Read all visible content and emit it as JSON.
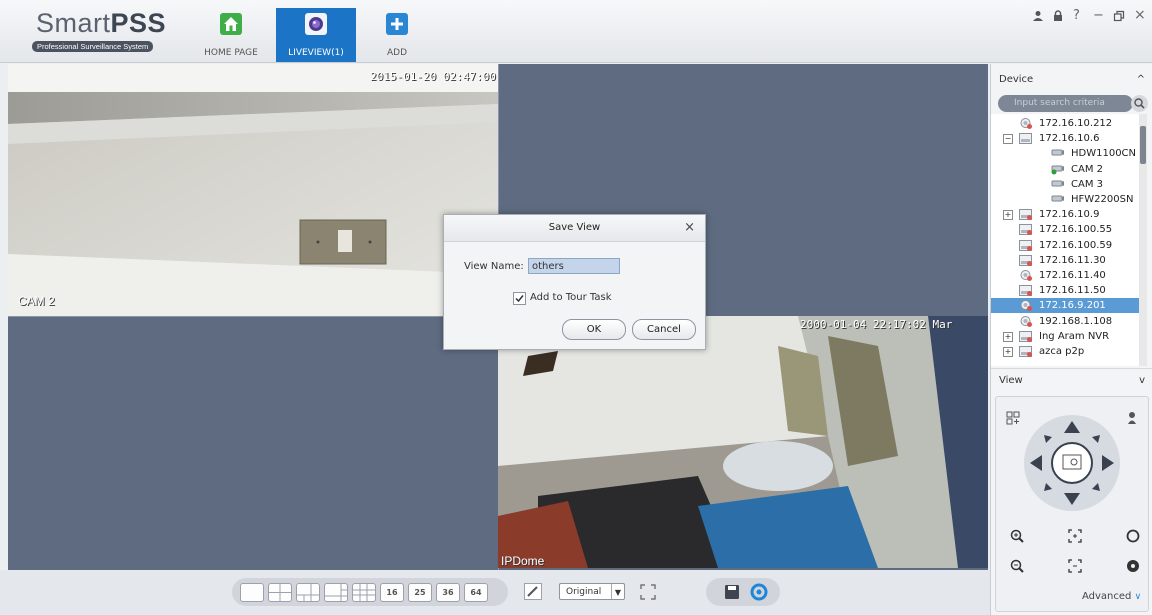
{
  "app": {
    "logo_title_light": "Smart",
    "logo_title_bold": "PSS",
    "logo_subtitle": "Professional Surveillance System"
  },
  "tabs": [
    {
      "label": "HOME PAGE",
      "icon": "home-icon",
      "color": "#3fae49"
    },
    {
      "label": "LIVEVIEW(1)",
      "icon": "camera-lens-icon",
      "color": "#1b74c6",
      "active": true
    },
    {
      "label": "ADD",
      "icon": "plus-icon",
      "color": "#2a86d3"
    }
  ],
  "window_controls": {
    "user": "user-icon",
    "lock": "lock-icon",
    "help": "?",
    "minimize": "−",
    "restore": "restore-icon",
    "close": "×"
  },
  "video": {
    "cam1": {
      "timestamp": "2015-01-20 02:47:00",
      "name": "CAM 2"
    },
    "cam2": {
      "timestamp": "2000-01-04 22:17:02 Mar",
      "name": "IPDome"
    }
  },
  "toolbar": {
    "layout_buttons": [
      "",
      "",
      "",
      "",
      "",
      "16",
      "25",
      "36",
      "64"
    ],
    "stream_select": "Original"
  },
  "device_panel": {
    "title": "Device",
    "search_placeholder": "Input search criteria",
    "tree": [
      {
        "label": "172.16.10.212",
        "indent": 0,
        "type": "dvr-online"
      },
      {
        "label": "172.16.10.6",
        "indent": 0,
        "type": "dvr",
        "expander": "−"
      },
      {
        "label": "HDW1100CN",
        "indent": 2,
        "type": "cam"
      },
      {
        "label": "CAM 2",
        "indent": 2,
        "type": "cam-live"
      },
      {
        "label": "CAM 3",
        "indent": 2,
        "type": "cam"
      },
      {
        "label": "HFW2200SN",
        "indent": 2,
        "type": "cam"
      },
      {
        "label": "172.16.10.9",
        "indent": 0,
        "type": "dvr-off",
        "expander": "+"
      },
      {
        "label": "172.16.100.55",
        "indent": 0,
        "type": "dvr-off"
      },
      {
        "label": "172.16.100.59",
        "indent": 0,
        "type": "dvr-off"
      },
      {
        "label": "172.16.11.30",
        "indent": 0,
        "type": "dvr-off"
      },
      {
        "label": "172.16.11.40",
        "indent": 0,
        "type": "dvr-online"
      },
      {
        "label": "172.16.11.50",
        "indent": 0,
        "type": "dvr-off"
      },
      {
        "label": "172.16.9.201",
        "indent": 0,
        "type": "dvr-online",
        "selected": true
      },
      {
        "label": "192.168.1.108",
        "indent": 0,
        "type": "dvr-online"
      },
      {
        "label": "Ing Aram NVR",
        "indent": 0,
        "type": "dvr-off",
        "expander": "+"
      },
      {
        "label": "azca p2p",
        "indent": 0,
        "type": "dvr-off",
        "expander": "+"
      }
    ]
  },
  "view_panel": {
    "title": "View"
  },
  "ptz": {
    "advanced_label": "Advanced"
  },
  "dialog": {
    "title": "Save View",
    "view_name_label": "View Name:",
    "view_name_value": "others",
    "checkbox_label": "Add to Tour Task",
    "checkbox_checked": true,
    "ok_label": "OK",
    "cancel_label": "Cancel"
  }
}
